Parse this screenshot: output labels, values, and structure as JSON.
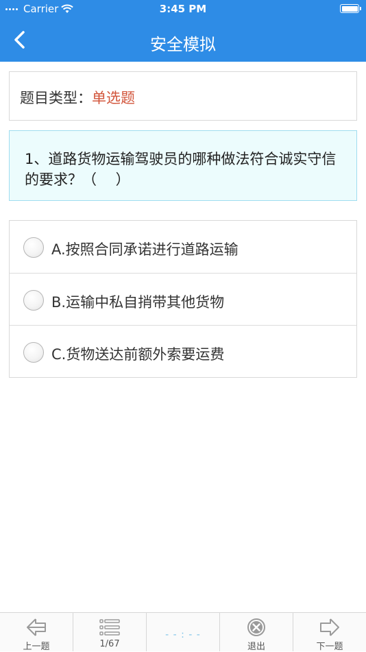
{
  "status_bar": {
    "carrier": "Carrier",
    "time": "3:45 PM",
    "battery_level": 1.0
  },
  "nav": {
    "title": "安全模拟",
    "back_icon": "chevron-left-icon"
  },
  "question_type": {
    "label": "题目类型：",
    "value": "单选题"
  },
  "question": {
    "text": "1、道路货物运输驾驶员的哪种做法符合诚实守信的要求？（　 ）"
  },
  "options": [
    {
      "label": "A.按照合同承诺进行道路运输",
      "selected": false
    },
    {
      "label": "B.运输中私自捎带其他货物",
      "selected": false
    },
    {
      "label": "C.货物送达前额外索要运费",
      "selected": false
    }
  ],
  "tabs": {
    "prev": {
      "label": "上一题",
      "icon": "arrow-left-icon"
    },
    "list": {
      "label": "1/67",
      "icon": "list-icon"
    },
    "center": {
      "mark": "- - : - -"
    },
    "exit": {
      "label": "退出",
      "icon": "close-circle-icon"
    },
    "next": {
      "label": "下一题",
      "icon": "arrow-right-icon"
    }
  },
  "colors": {
    "primary": "#2e8ce6",
    "accent": "#d2553b",
    "question_bg": "#ecfcfd"
  }
}
